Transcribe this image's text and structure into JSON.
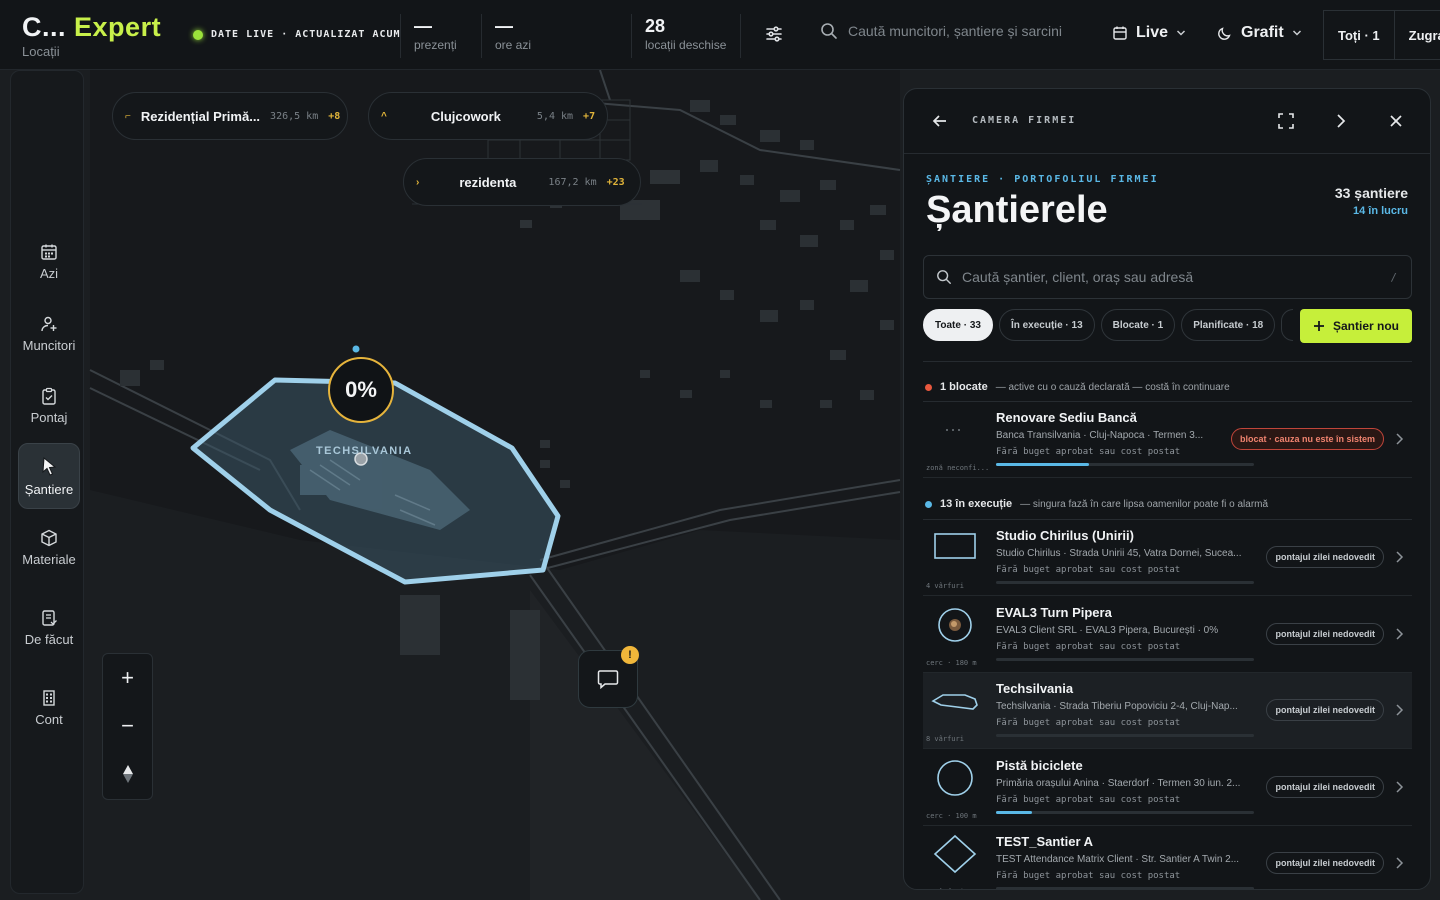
{
  "brand": {
    "title_a": "C...",
    "title_b": "Expert",
    "subtitle": "Locații"
  },
  "live": {
    "label": "DATE LIVE · ACTUALIZAT ACUM"
  },
  "stats": [
    {
      "value": "—",
      "label": "prezenți"
    },
    {
      "value": "—",
      "label": "ore azi"
    },
    {
      "value": "28",
      "label": "locații deschise"
    }
  ],
  "search": {
    "placeholder": "Caută muncitori, șantiere și sarcini"
  },
  "toolbar": {
    "live_label": "Live",
    "theme_label": "Grafit",
    "filter_all": "Toți · 1",
    "filter_zugra": "Zugra"
  },
  "nav": [
    {
      "label": "Azi",
      "icon": "calendar-icon"
    },
    {
      "label": "Muncitori",
      "icon": "user-plus-icon"
    },
    {
      "label": "Pontaj",
      "icon": "clipboard-check-icon"
    },
    {
      "label": "Șantiere",
      "icon": "cursor-pointer-icon",
      "active": true
    },
    {
      "label": "Materiale",
      "icon": "cube-icon"
    },
    {
      "label": "De făcut",
      "icon": "checklist-icon"
    },
    {
      "label": "Cont",
      "icon": "building-icon"
    }
  ],
  "map": {
    "pills": [
      {
        "name": "Rezidențial Primă...",
        "km": "326,5 km",
        "plus": "+8"
      },
      {
        "name": "Clujcowork",
        "km": "5,4 km",
        "plus": "+7"
      },
      {
        "name": "rezidenta",
        "km": "167,2 km",
        "plus": "+23"
      }
    ],
    "site_progress": "0%",
    "site_label": "TECHSILVANIA",
    "chat_badge": "!"
  },
  "panel": {
    "header_title": "CAMERA FIRMEI",
    "eyebrow": "ȘANTIERE · PORTOFOLIUL FIRMEI",
    "title": "Șantierele",
    "count_total": "33 șantiere",
    "count_active": "14 în lucru",
    "search_placeholder": "Caută șantier, client, oraș sau adresă",
    "search_shortcut": "/",
    "chips": [
      "Toate · 33",
      "În execuție · 13",
      "Blocate · 1",
      "Planificate · 18"
    ],
    "new_button": "Șantier nou",
    "section_blocked": {
      "count": "1 blocate",
      "desc": "— active cu o cauză declarată — costă în continuare",
      "color": "#e8583e"
    },
    "section_exec": {
      "count": "13 în execuție",
      "desc": "— singura fază în care lipsa oamenilor poate fi o alarmă",
      "color": "#5ab8e6"
    },
    "blocked_rows": [
      {
        "name": "Renovare Sediu Bancă",
        "meta": "Banca Transilvania · Cluj-Napoca · Termen 3...",
        "budget": "Fără buget aprobat sau cost postat",
        "badge": "blocat · cauza nu este în sistem",
        "thumb": "zonă neconfi...",
        "shape": "dots",
        "progress": 0.36
      }
    ],
    "exec_rows": [
      {
        "name": "Studio Chirilus (Unirii)",
        "meta": "Studio Chirilus · Strada Unirii 45, Vatra Dornei, Sucea...",
        "budget": "Fără buget aprobat sau cost postat",
        "badge": "pontajul zilei nedovedit",
        "thumb": "4 vârfuri",
        "shape": "rect",
        "progress": 0
      },
      {
        "name": "EVAL3 Turn Pipera",
        "meta": "EVAL3 Client SRL · EVAL3 Pipera, București · 0%",
        "budget": "Fără buget aprobat sau cost postat",
        "badge": "pontajul zilei nedovedit",
        "thumb": "cerc · 180 m",
        "shape": "photo",
        "progress": 0
      },
      {
        "name": "Techsilvania",
        "meta": "Techsilvania · Strada Tiberiu Popoviciu 2-4, Cluj-Nap...",
        "budget": "Fără buget aprobat sau cost postat",
        "badge": "pontajul zilei nedovedit",
        "thumb": "8 vârfuri",
        "shape": "poly",
        "progress": 0,
        "highlight": true
      },
      {
        "name": "Pistă biciclete",
        "meta": "Primăria orașului Anina · Staerdorf · Termen 30 iun. 2...",
        "budget": "Fără buget aprobat sau cost postat",
        "badge": "pontajul zilei nedovedit",
        "thumb": "cerc · 100 m",
        "shape": "circle",
        "progress": 0.14
      },
      {
        "name": "TEST_Santier A",
        "meta": "TEST Attendance Matrix Client · Str. Santier A Twin 2...",
        "budget": "Fără buget aprobat sau cost postat",
        "badge": "pontajul zilei nedovedit",
        "thumb": "4 vârfuri",
        "shape": "diamond",
        "progress": 0
      }
    ]
  }
}
